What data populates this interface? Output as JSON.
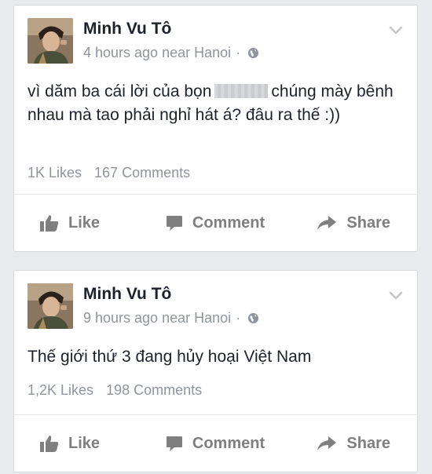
{
  "posts": [
    {
      "author": "Minh Vu Tô",
      "time": "4 hours ago near Hanoi",
      "separator": "·",
      "text_before": "vì dăm ba cái lời của bọn",
      "text_after": "chúng mày bênh nhau mà tao phải nghỉ hát á? đâu ra thế :))",
      "likes": "1K Likes",
      "comments": "167 Comments"
    },
    {
      "author": "Minh Vu Tô",
      "time": "9 hours ago near Hanoi",
      "separator": "·",
      "text": "Thế giới thứ 3 đang hủy hoại Việt Nam",
      "likes": "1,2K Likes",
      "comments": "198 Comments"
    }
  ],
  "actions": {
    "like": "Like",
    "comment": "Comment",
    "share": "Share"
  },
  "icons": {
    "avatar": "avatar-photo",
    "privacy": "globe-icon",
    "menu": "chevron-down-icon",
    "like": "thumbs-up-icon",
    "comment": "speech-bubble-icon",
    "share": "share-arrow-icon"
  },
  "colors": {
    "background": "#e9eaee",
    "text": "#1d2129",
    "meta": "#90949c",
    "action": "#7f7f7f"
  }
}
